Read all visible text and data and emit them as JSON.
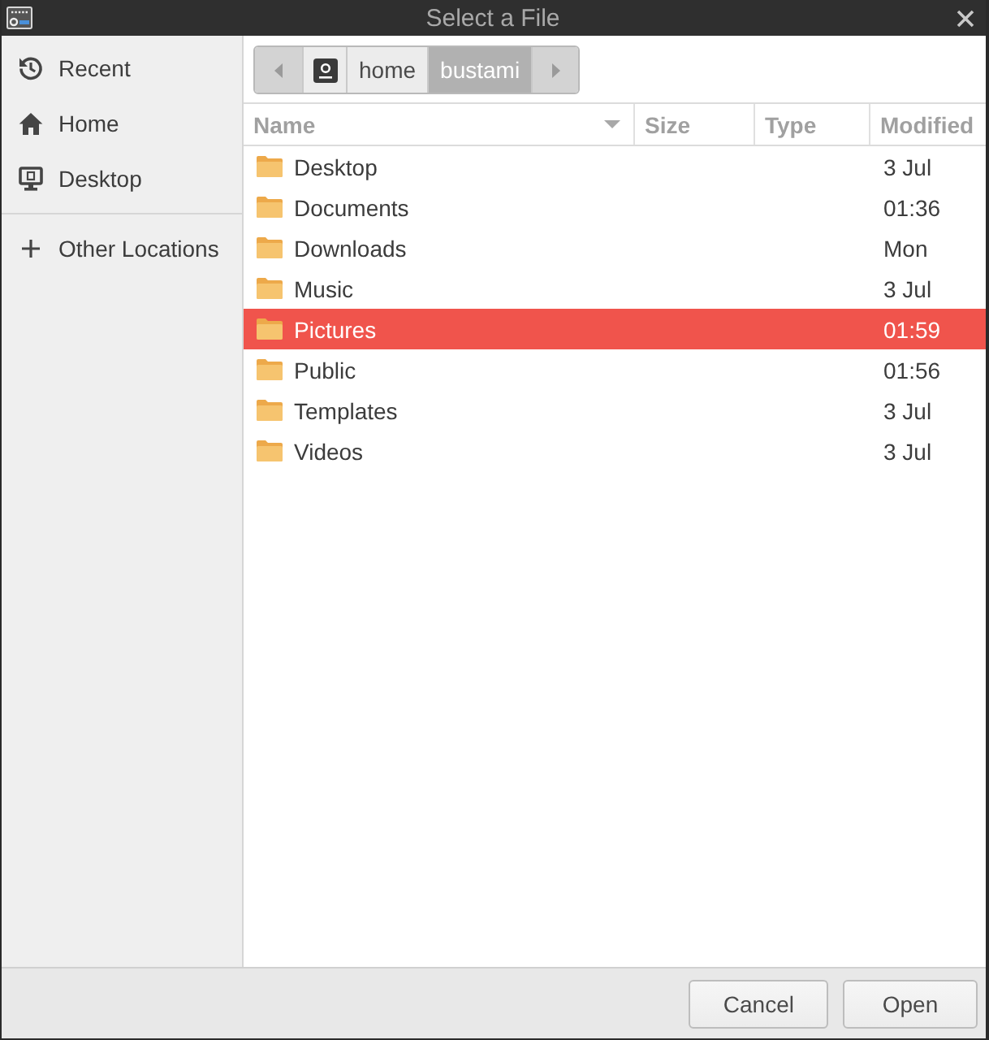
{
  "window": {
    "title": "Select a File"
  },
  "sidebar": {
    "places": [
      {
        "kind": "recent",
        "label": "Recent"
      },
      {
        "kind": "home",
        "label": "Home"
      },
      {
        "kind": "desktop",
        "label": "Desktop"
      }
    ],
    "other": {
      "kind": "add",
      "label": "Other Locations"
    }
  },
  "path_bar": {
    "segments": [
      {
        "kind": "device",
        "selected": false
      },
      {
        "kind": "text",
        "label": "home",
        "selected": false
      },
      {
        "kind": "text",
        "label": "bustami",
        "selected": true
      }
    ]
  },
  "table": {
    "columns": [
      {
        "label": "Name",
        "sorted": true
      },
      {
        "label": "Size",
        "sorted": false
      },
      {
        "label": "Type",
        "sorted": false
      },
      {
        "label": "Modified",
        "sorted": false
      }
    ],
    "rows": [
      {
        "name": "Desktop",
        "modified": "3 Jul",
        "selected": false
      },
      {
        "name": "Documents",
        "modified": "01:36",
        "selected": false
      },
      {
        "name": "Downloads",
        "modified": "Mon",
        "selected": false
      },
      {
        "name": "Music",
        "modified": "3 Jul",
        "selected": false
      },
      {
        "name": "Pictures",
        "modified": "01:59",
        "selected": true
      },
      {
        "name": "Public",
        "modified": "01:56",
        "selected": false
      },
      {
        "name": "Templates",
        "modified": "3 Jul",
        "selected": false
      },
      {
        "name": "Videos",
        "modified": "3 Jul",
        "selected": false
      }
    ]
  },
  "buttons": [
    {
      "label": "Cancel"
    },
    {
      "label": "Open"
    }
  ]
}
